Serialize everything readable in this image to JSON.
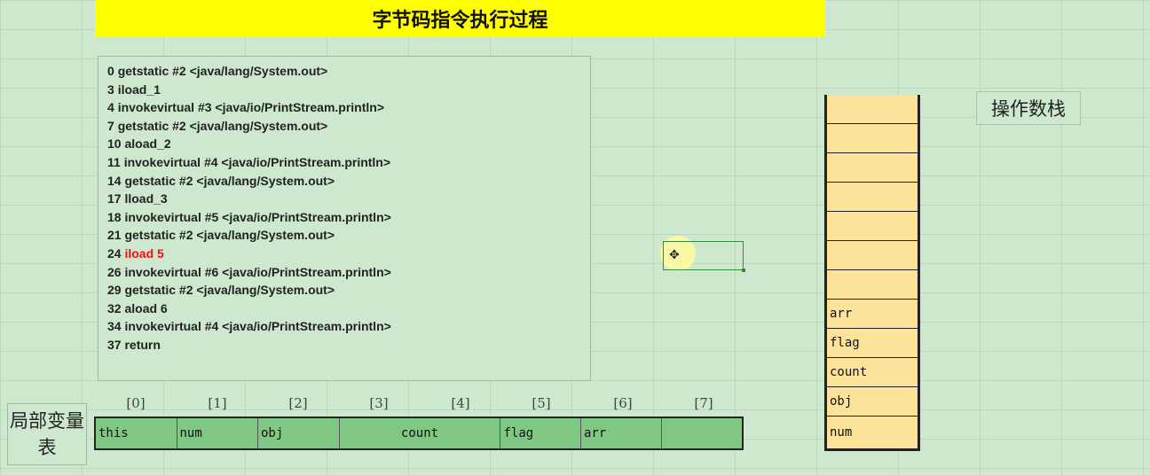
{
  "title": "字节码指令执行过程",
  "code_lines": [
    {
      "num": "0",
      "text": "getstatic #2 <java/lang/System.out>",
      "highlight": false
    },
    {
      "num": "3",
      "text": "iload_1",
      "highlight": false
    },
    {
      "num": "4",
      "text": "invokevirtual #3 <java/io/PrintStream.println>",
      "highlight": false
    },
    {
      "num": "7",
      "text": "getstatic #2 <java/lang/System.out>",
      "highlight": false
    },
    {
      "num": "10",
      "text": "aload_2",
      "highlight": false
    },
    {
      "num": "11",
      "text": "invokevirtual #4 <java/io/PrintStream.println>",
      "highlight": false
    },
    {
      "num": "14",
      "text": "getstatic #2 <java/lang/System.out>",
      "highlight": false
    },
    {
      "num": "17",
      "text": "lload_3",
      "highlight": false
    },
    {
      "num": "18",
      "text": "invokevirtual #5 <java/io/PrintStream.println>",
      "highlight": false
    },
    {
      "num": "21",
      "text": "getstatic #2 <java/lang/System.out>",
      "highlight": false
    },
    {
      "num": "24",
      "text": "iload 5",
      "highlight": true
    },
    {
      "num": "26",
      "text": "invokevirtual #6 <java/io/PrintStream.println>",
      "highlight": false
    },
    {
      "num": "29",
      "text": "getstatic #2 <java/lang/System.out>",
      "highlight": false
    },
    {
      "num": "32",
      "text": "aload 6",
      "highlight": false
    },
    {
      "num": "34",
      "text": "invokevirtual #4 <java/io/PrintStream.println>",
      "highlight": false
    },
    {
      "num": "37",
      "text": "return",
      "highlight": false
    }
  ],
  "local_var_table": {
    "label": "局部变量表",
    "indices": [
      "[0]",
      "[1]",
      "[2]",
      "[3]",
      "[4]",
      "[5]",
      "[6]",
      "[7]"
    ],
    "slots": [
      "this",
      "num",
      "obj",
      "count",
      "flag",
      "arr",
      ""
    ]
  },
  "operand_stack": {
    "label": "操作数栈",
    "cells_top_to_bottom": [
      "",
      "",
      "",
      "",
      "",
      "",
      "",
      "arr",
      "flag",
      "count",
      "obj",
      "num"
    ]
  },
  "colors": {
    "background": "#cde8cf",
    "title_bar": "#ffff00",
    "highlight_text": "#ee1111",
    "slot_fill": "#80c783",
    "stack_fill": "#fde29a"
  },
  "icons": {
    "cursor": "cell-select-cross-icon"
  }
}
